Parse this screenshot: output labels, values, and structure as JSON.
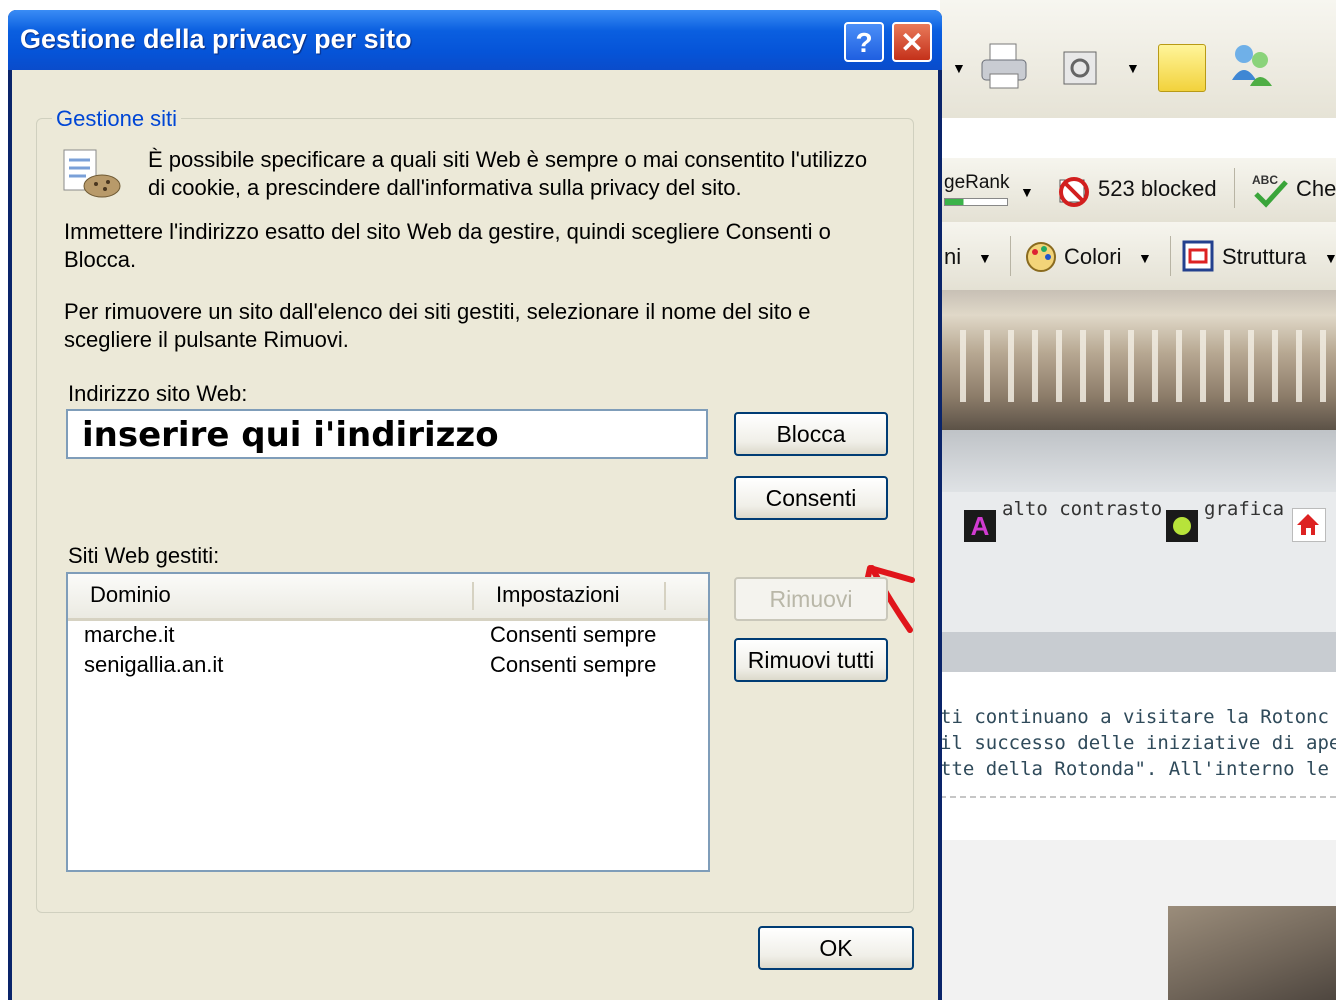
{
  "dialog": {
    "title": "Gestione della privacy per sito",
    "help_glyph": "?",
    "close_glyph": "✕",
    "group_label": "Gestione siti",
    "intro": "È possibile specificare a quali siti Web è sempre o mai consentito l'utilizzo di cookie, a prescindere dall'informativa sulla privacy del sito.",
    "instruction": "Immettere l'indirizzo esatto del sito Web da gestire, quindi scegliere Consenti o Blocca.",
    "remove_instruction": "Per rimuovere un sito dall'elenco dei siti gestiti, selezionare il nome del sito e scegliere il pulsante Rimuovi.",
    "address_label": "Indirizzo sito Web:",
    "address_value": "inserire qui i'indirizzo",
    "block_button": "Blocca",
    "allow_button": "Consenti",
    "managed_label": "Siti Web gestiti:",
    "columns": [
      "Dominio",
      "Impostazioni"
    ],
    "rows": [
      {
        "domain": "marche.it",
        "setting": "Consenti sempre"
      },
      {
        "domain": "senigallia.an.it",
        "setting": "Consenti sempre"
      }
    ],
    "remove_button": "Rimuovi",
    "remove_all_button": "Rimuovi tutti",
    "ok_button": "OK",
    "annotation_color": "#e0151b"
  },
  "background_window": {
    "pagerank_label": "geRank",
    "blocked_label": "523 blocked",
    "spell_label": "Che",
    "menu_fragment": "ni",
    "colori_label": "Colori",
    "struttura_label": "Struttura",
    "link_contrast": "alto contrasto",
    "link_grafica": "grafica",
    "article_lines": [
      "ti continuano a visitare la Rotonc",
      " il successo delle iniziative di ape",
      "tte della Rotonda\". All'interno le"
    ]
  }
}
